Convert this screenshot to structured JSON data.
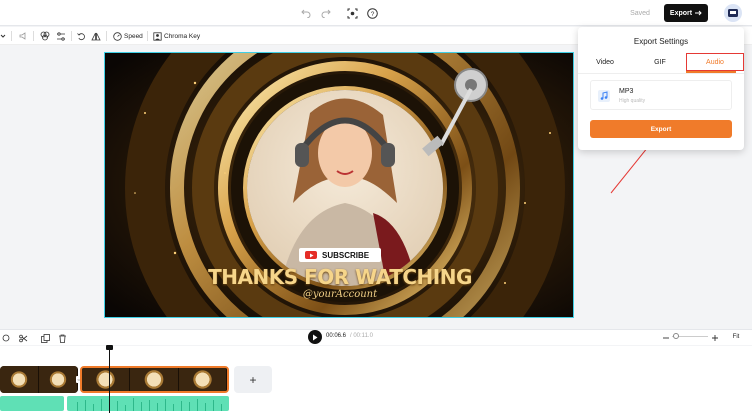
{
  "topbar": {
    "saved_label": "Saved",
    "export_label": "Export",
    "icons": [
      "undo-icon",
      "redo-icon",
      "screen-capture-icon",
      "help-icon",
      "arrow-right-icon",
      "avatar"
    ]
  },
  "toolbar": {
    "speed_label": "Speed",
    "chroma_key_label": "Chroma Key"
  },
  "video": {
    "subscribe_label": "SUBSCRIBE",
    "thanks_text": "THANKS FOR WATCHING",
    "handle_text": "@yourAccount"
  },
  "export_panel": {
    "title": "Export Settings",
    "tabs": [
      {
        "label": "Video"
      },
      {
        "label": "GIF"
      },
      {
        "label": "Audio",
        "active": true
      }
    ],
    "format_name": "MP3",
    "format_quality": "High quality",
    "export_button": "Export"
  },
  "timeline": {
    "current_time": "00:06.6",
    "total_time": "00:11.0",
    "fit_label": "Fit",
    "add_label": "+"
  },
  "colors": {
    "accent": "#f07b2a",
    "highlight_border": "#e53935",
    "selection": "#3fd0e6",
    "audio": "#5fe0b5"
  }
}
